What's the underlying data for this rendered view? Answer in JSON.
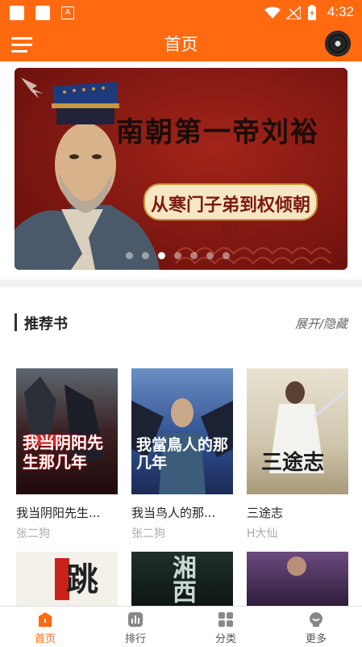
{
  "status_bar": {
    "time": "4:32",
    "a_badge": "A"
  },
  "app_bar": {
    "title": "首页"
  },
  "banner": {
    "headline": "南朝第一帝刘裕",
    "subtitle": "从寒门子弟到权倾朝野",
    "page_count": 7,
    "active_index": 2
  },
  "recommend": {
    "title": "推荐书",
    "toggle_label": "展开/隐藏",
    "books": [
      {
        "title": "我当阴阳先生...",
        "author": "张二狗",
        "cover_text": "我当阴阳先生那几年"
      },
      {
        "title": "我当鸟人的那...",
        "author": "张二狗",
        "cover_text": "我當鳥人的那几年"
      },
      {
        "title": "三途志",
        "author": "H大仙",
        "cover_text": "三途志"
      }
    ],
    "row2_covers": [
      "跳",
      "湘西",
      ""
    ]
  },
  "tabs": [
    {
      "label": "首页",
      "icon": "home-icon",
      "active": true
    },
    {
      "label": "排行",
      "icon": "ranking-icon",
      "active": false
    },
    {
      "label": "分类",
      "icon": "category-icon",
      "active": false
    },
    {
      "label": "更多",
      "icon": "more-icon",
      "active": false
    }
  ],
  "colors": {
    "accent": "#ff6a10",
    "banner_red": "#8f1a14"
  }
}
